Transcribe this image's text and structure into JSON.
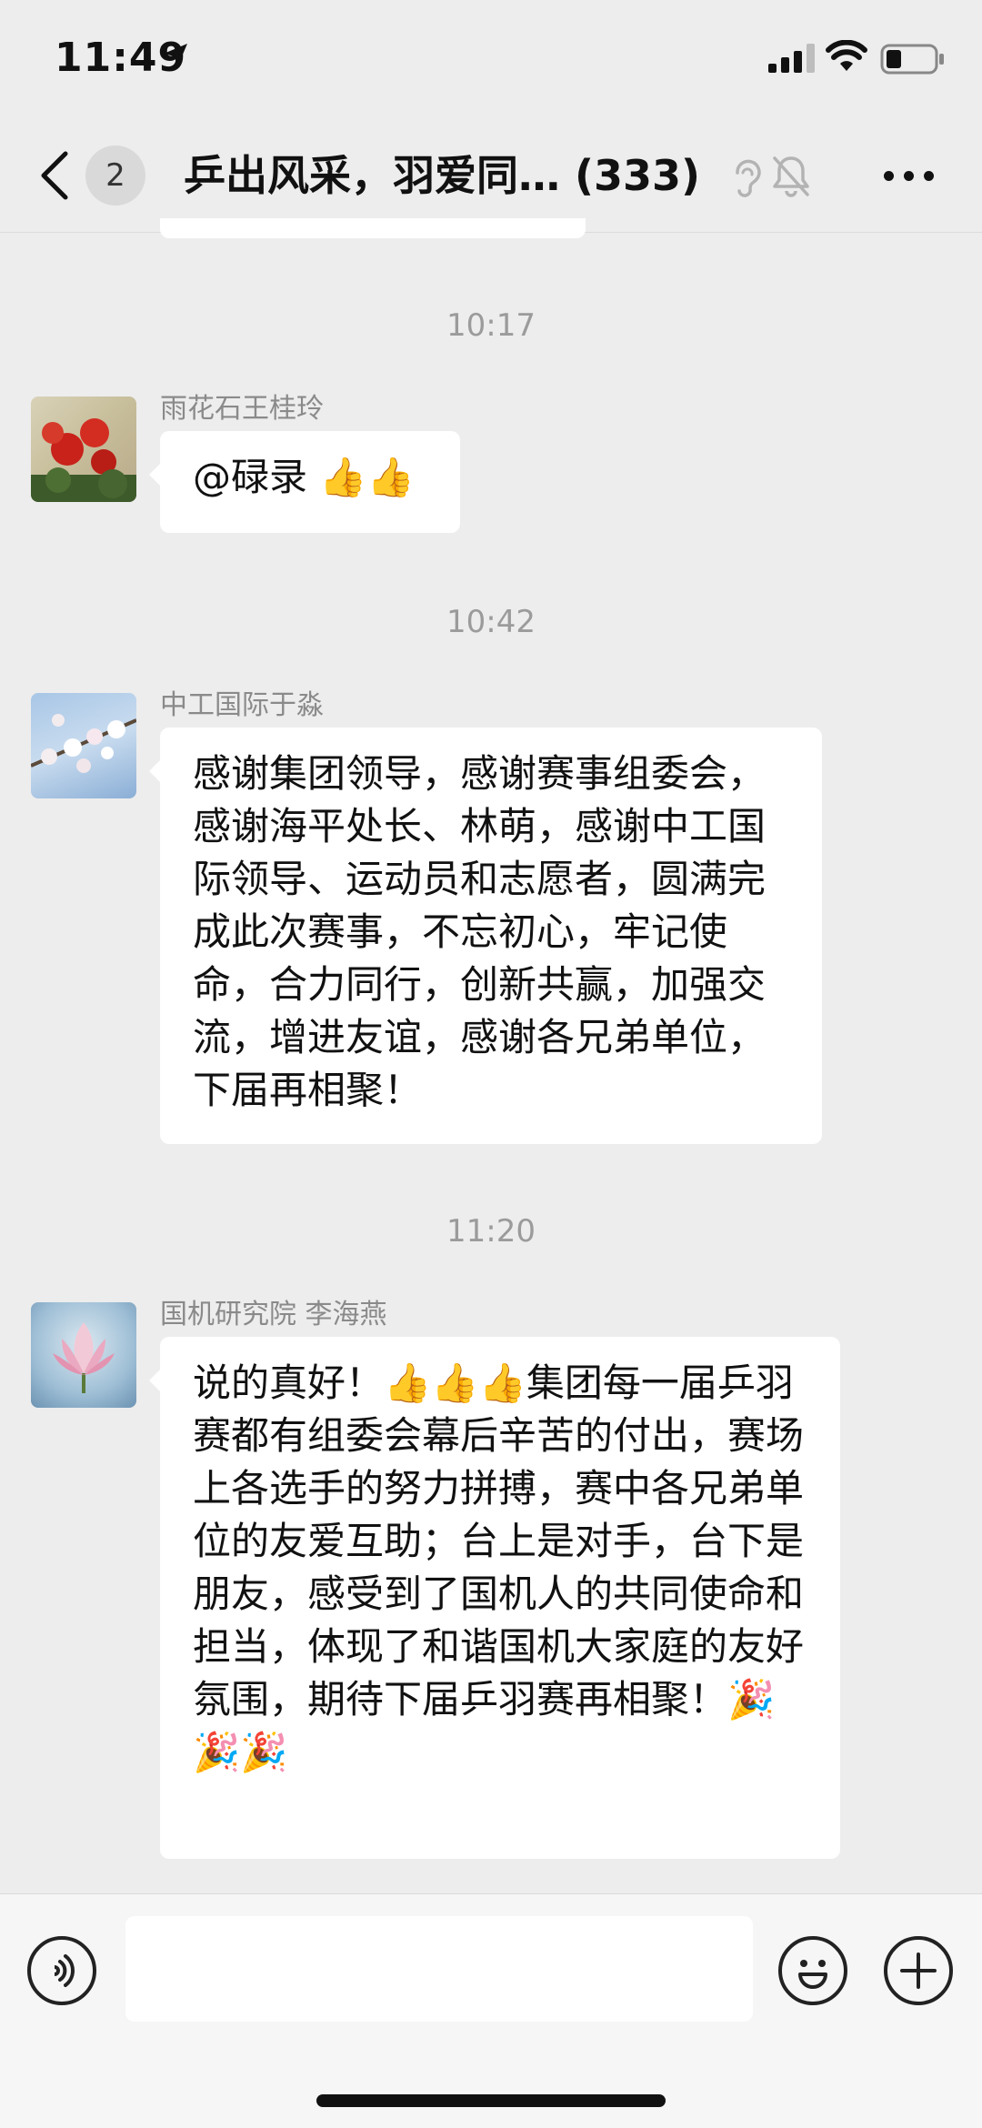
{
  "status_bar": {
    "time": "11:49"
  },
  "nav": {
    "back_badge": "2",
    "title": "乒出风采，羽爱同… (333)"
  },
  "icons": {
    "location": "location-arrow-icon",
    "signal": "cellular-signal-icon",
    "wifi": "wifi-icon",
    "battery": "battery-icon",
    "back": "chevron-left-icon",
    "earpiece": "ear-icon",
    "mute": "bell-slash-icon",
    "more": "more-dots-icon",
    "voice": "voice-icon",
    "emoji": "smiley-icon",
    "plus": "plus-icon"
  },
  "messages": [
    {
      "time": "10:17",
      "sender": "雨花石王桂玲",
      "text": "@碌录 👍👍"
    },
    {
      "time": "10:42",
      "sender": "中工国际于淼",
      "text": "感谢集团领导，感谢赛事组委会，感谢海平处长、林萌，感谢中工国际领导、运动员和志愿者，圆满完成此次赛事，不忘初心，牢记使命，合力同行，创新共赢，加强交流，增进友谊，感谢各兄弟单位，下届再相聚！"
    },
    {
      "time": "11:20",
      "sender": "国机研究院 李海燕",
      "text": "说的真好！👍👍👍集团每一届乒羽赛都有组委会幕后辛苦的付出，赛场上各选手的努力拼搏，赛中各兄弟单位的友爱互助；台上是对手，台下是朋友，感受到了国机人的共同使命和担当，体现了和谐国机大家庭的友好氛围，期待下届乒羽赛再相聚！🎉🎉🎉"
    }
  ],
  "input": {
    "placeholder": ""
  }
}
